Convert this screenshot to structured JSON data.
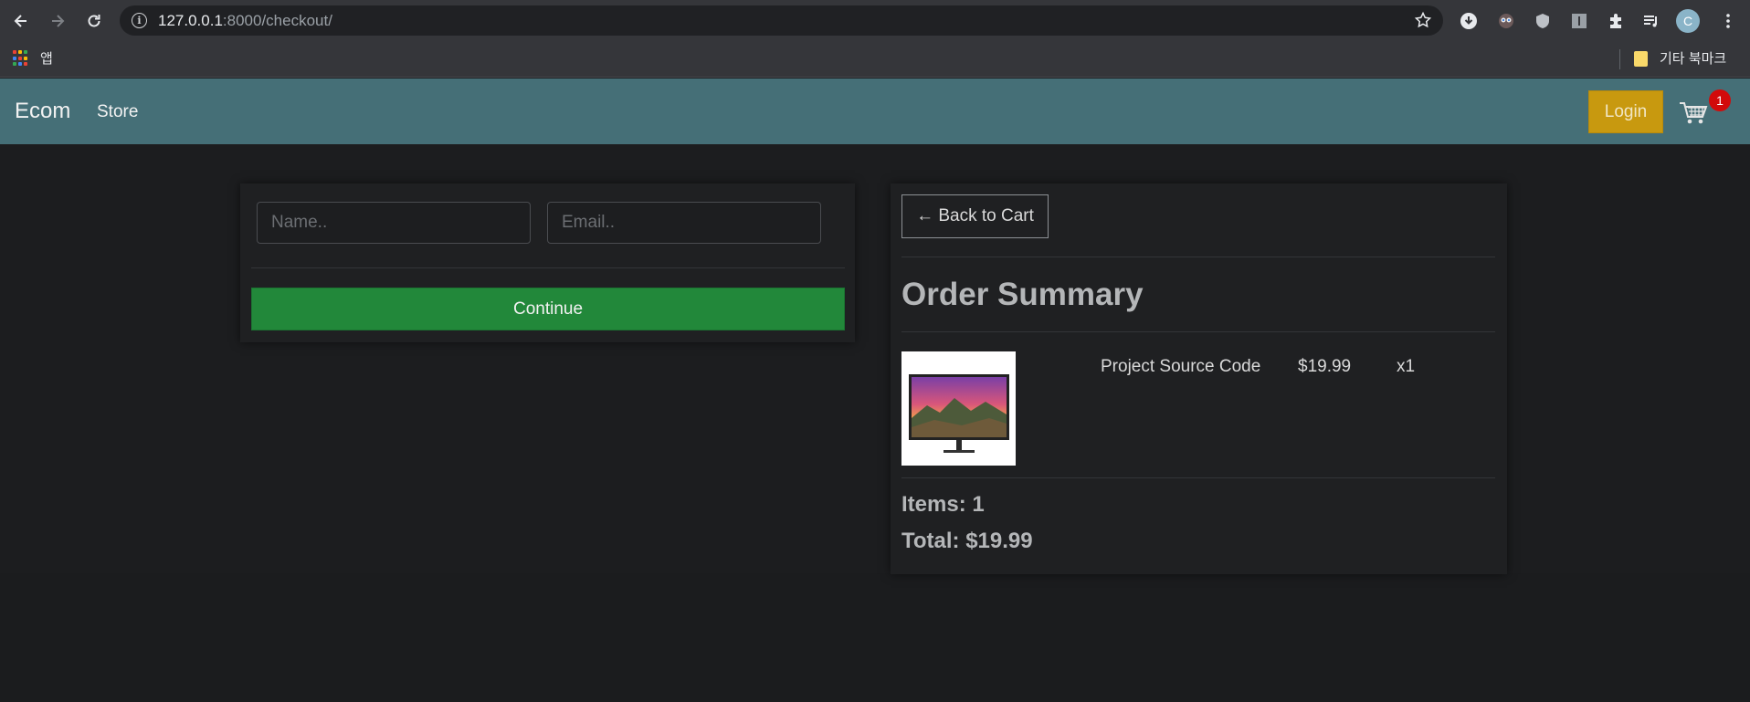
{
  "browser": {
    "url_host": "127.0.0.1",
    "url_rest": ":8000/checkout/",
    "profile_initial": "C",
    "bookmarks": {
      "apps_label": "앱",
      "other_label": "기타 북마크"
    }
  },
  "navbar": {
    "brand": "Ecom",
    "store_link": "Store",
    "login_label": "Login",
    "cart_count": "1",
    "color": "#456f77"
  },
  "form": {
    "name_placeholder": "Name..",
    "email_placeholder": "Email..",
    "continue_label": "Continue"
  },
  "summary": {
    "back_label": "← Back to Cart",
    "title": "Order Summary",
    "items": [
      {
        "name": "Project Source Code",
        "price": "$19.99",
        "quantity": "x1"
      }
    ],
    "items_line": "Items: 1",
    "total_line": "Total: $19.99"
  },
  "colors": {
    "accent_login": "#c8990f",
    "continue_green": "#22883a",
    "badge_red": "#d20a0a"
  }
}
